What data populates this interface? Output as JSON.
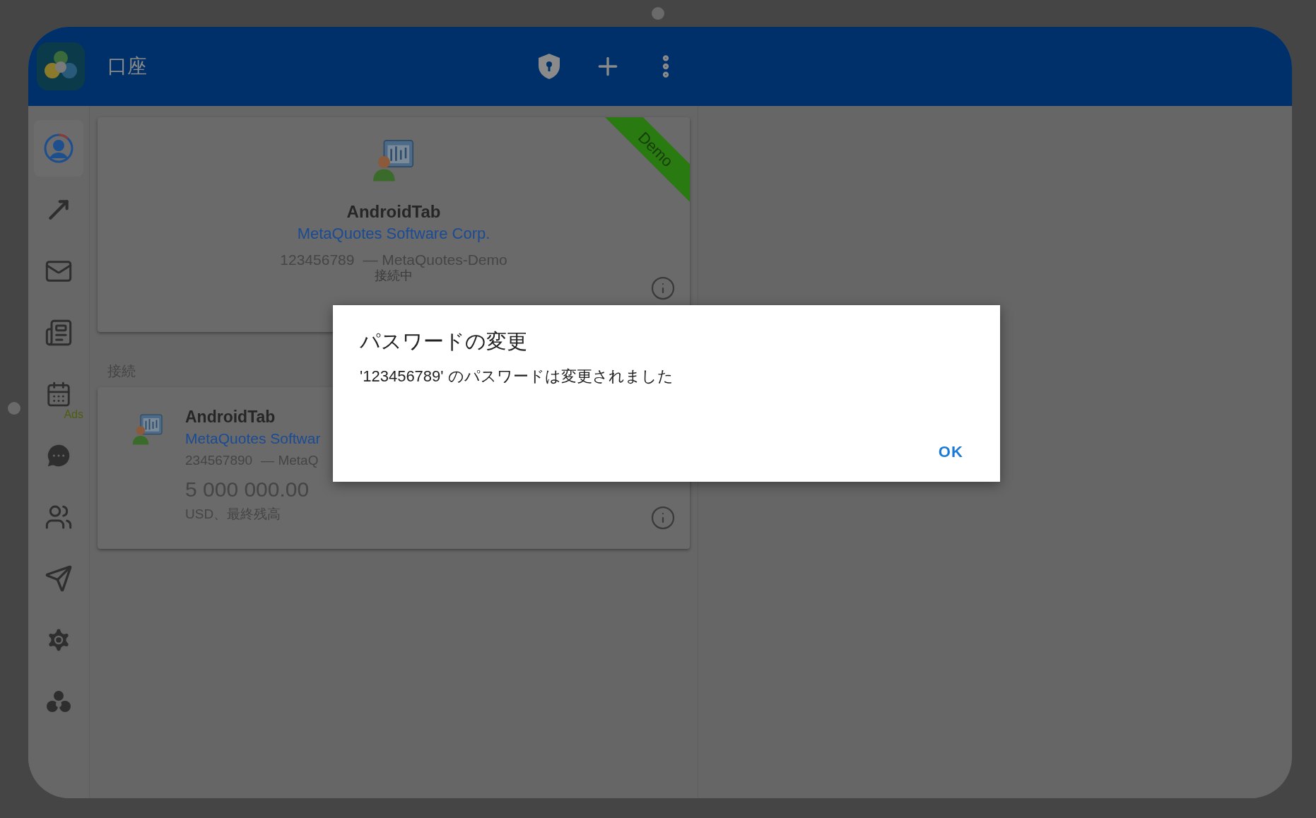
{
  "header": {
    "title": "口座"
  },
  "sidebar": {
    "items": [
      {
        "kind": "account",
        "selected": true
      },
      {
        "kind": "trade",
        "selected": false
      },
      {
        "kind": "mail",
        "selected": false
      },
      {
        "kind": "news",
        "selected": false
      },
      {
        "kind": "calendar",
        "selected": false,
        "badge": "Ads"
      },
      {
        "kind": "chat",
        "selected": false
      },
      {
        "kind": "community",
        "selected": false
      },
      {
        "kind": "send",
        "selected": false
      },
      {
        "kind": "settings",
        "selected": false
      },
      {
        "kind": "about",
        "selected": false
      }
    ]
  },
  "current_account": {
    "name": "AndroidTab",
    "company": "MetaQuotes Software Corp.",
    "login": "123456789",
    "server": "— MetaQuotes-Demo",
    "status": "接続中",
    "badge": "Demo"
  },
  "section_label": "接続",
  "accounts": [
    {
      "name": "AndroidTab",
      "company": "MetaQuotes Softwar",
      "login": "234567890",
      "server": "— MetaQ",
      "balance": "5 000 000.00",
      "balance_label": "USD、最終残高"
    }
  ],
  "dialog": {
    "title": "パスワードの変更",
    "message": "'123456789' のパスワードは変更されました",
    "buttons": [
      "OK"
    ]
  }
}
